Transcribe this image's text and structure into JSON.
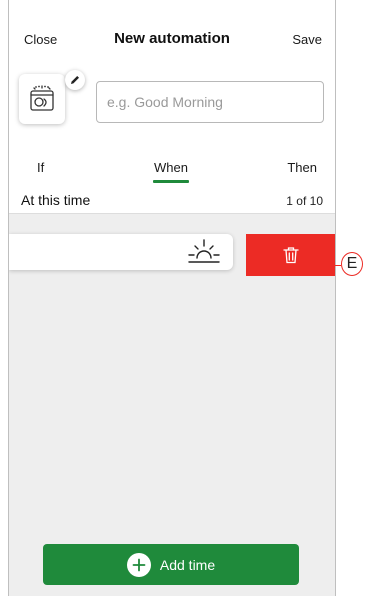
{
  "header": {
    "close_label": "Close",
    "title": "New automation",
    "save_label": "Save"
  },
  "automation": {
    "icon": "dishwasher-icon",
    "edit_icon": "pencil-icon",
    "name_value": "",
    "name_placeholder": "e.g. Good Morning"
  },
  "tabs": [
    {
      "label": "If",
      "active": false
    },
    {
      "label": "When",
      "active": true
    },
    {
      "label": "Then",
      "active": false
    }
  ],
  "section": {
    "title": "At this time",
    "count": "1 of 10"
  },
  "time_entries": [
    {
      "icon": "sunrise-icon"
    }
  ],
  "delete": {
    "icon": "trash-icon"
  },
  "add_button": {
    "label": "Add time",
    "icon": "plus-icon"
  },
  "callout": {
    "label": "E"
  },
  "colors": {
    "accent_green": "#1f8a3b",
    "delete_red": "#ec2b25",
    "content_bg": "#eeeeee"
  }
}
